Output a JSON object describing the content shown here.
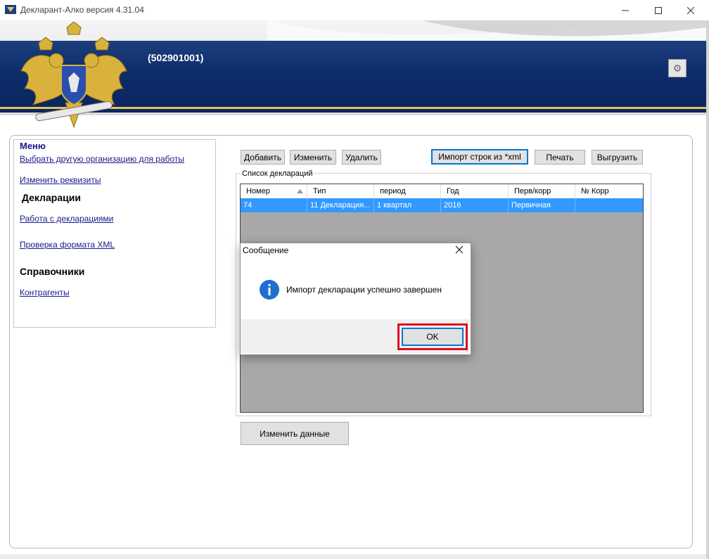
{
  "window": {
    "title": "Декларант-Алко версия 4.31.04",
    "minimize_icon": "minimize-icon",
    "maximize_icon": "maximize-icon",
    "close_icon": "close-icon"
  },
  "banner": {
    "org_code": "(502901001)",
    "emblem_icon": "double-headed-eagle-emblem",
    "settings_icon": "gear-icon"
  },
  "menu": {
    "heading": "Меню",
    "items": [
      {
        "label": "Выбрать другую организацию для работы",
        "type": "link"
      },
      {
        "label": "Изменить реквизиты",
        "type": "link"
      }
    ],
    "sections": [
      {
        "heading": "Декларации",
        "items": [
          "Работа с декларациями",
          "Проверка формата XML"
        ]
      },
      {
        "heading": "Справочники",
        "items": [
          "Контрагенты"
        ]
      }
    ]
  },
  "toolbar": {
    "add": "Добавить",
    "edit": "Изменить",
    "delete": "Удалить",
    "import": "Импорт строк из *xml",
    "print": "Печать",
    "export": "Выгрузить"
  },
  "declarations": {
    "group_label": "Список деклараций",
    "columns": [
      "Номер",
      "Тип",
      "период",
      "Год",
      "Перв/корр",
      "№ Корр"
    ],
    "rows": [
      [
        "74",
        "11 Декларация...",
        "1 квартал",
        "2016",
        "Первичная",
        ""
      ]
    ]
  },
  "change_data_button": "Изменить данные",
  "dialog": {
    "title": "Сообщение",
    "message": "Импорт декларации успешно завершен",
    "ok": "OK",
    "icon": "info-icon"
  },
  "colors": {
    "banner_blue": "#0d2c6a",
    "banner_gold": "#e6c25a",
    "selection": "#3399ff",
    "grid_background": "#a8a8a8",
    "highlight": "#e0101e"
  }
}
